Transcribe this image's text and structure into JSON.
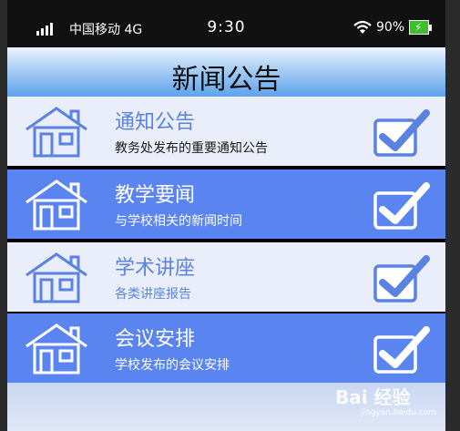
{
  "status_bar": {
    "carrier": "中国移动 4G",
    "time": "9:30",
    "battery_percent": "90%",
    "battery_color": "#3cbf2a"
  },
  "header": {
    "title": "新闻公告"
  },
  "items": [
    {
      "label": "通知公告",
      "description": "教务处发布的重要通知公告",
      "icon": "house-icon",
      "checked": true
    },
    {
      "label": "教学要闻",
      "description": "与学校相关的新闻时间",
      "icon": "house-icon",
      "checked": true
    },
    {
      "label": "学术讲座",
      "description": "各类讲座报告",
      "icon": "house-icon",
      "checked": true
    },
    {
      "label": "会议安排",
      "description": "学校发布的会议安排",
      "icon": "house-icon",
      "checked": true
    }
  ],
  "colors": {
    "accent": "#5a84f0",
    "light_row": "#eaeefa"
  },
  "watermark": {
    "main": "Bai 经验",
    "sub": "jingyan.baidu.com"
  }
}
